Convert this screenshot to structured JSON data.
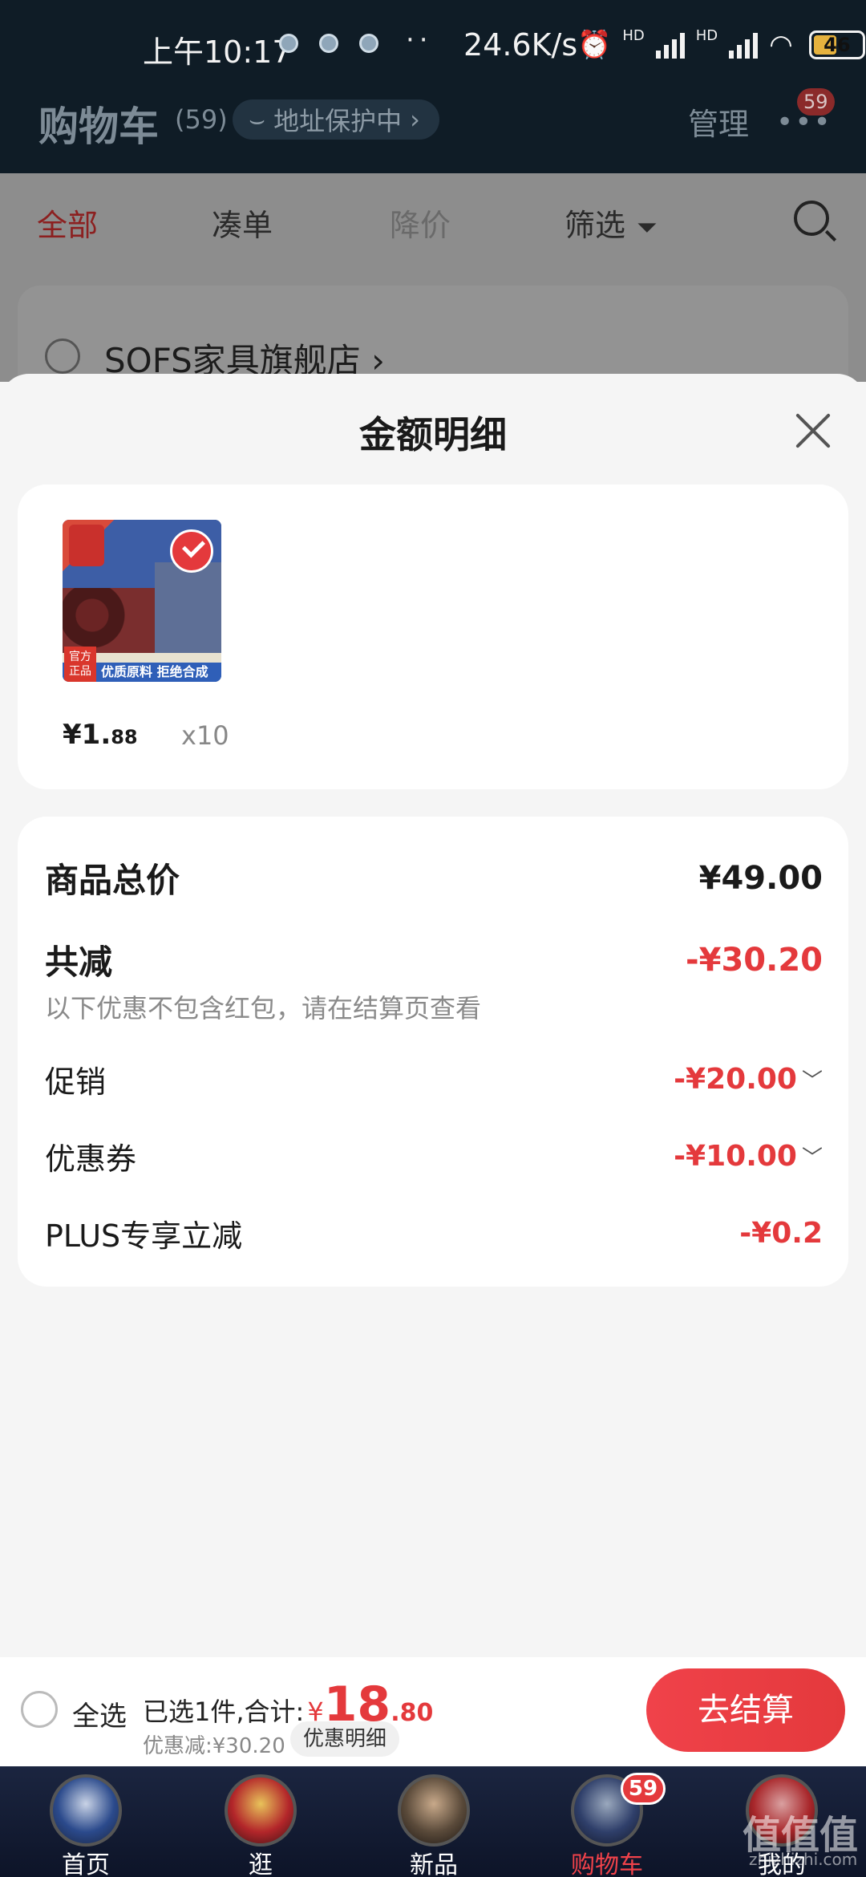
{
  "status_bar": {
    "time": "上午10:17",
    "speed": "24.6K/s",
    "more": "··",
    "hd1": "HD",
    "hd2": "HD",
    "battery": "46"
  },
  "header": {
    "title": "购物车",
    "count": "(59)",
    "address_protect": "地址保护中",
    "address_chevron": "›",
    "manage": "管理",
    "more_badge": "59"
  },
  "tabs": [
    {
      "label": "全部"
    },
    {
      "label": "凑单"
    },
    {
      "label": "降价"
    },
    {
      "label": "筛选"
    }
  ],
  "store": {
    "name": "SOFS家具旗舰店",
    "chevron": "›"
  },
  "sheet": {
    "title": "金额明细",
    "product": {
      "price_int": "¥1.",
      "price_dec": "88",
      "qty": "x10",
      "image_text_official": "官方正品",
      "image_text_banner": "优质原料 拒绝合成"
    },
    "summary": {
      "total_label": "商品总价",
      "total_value": "¥49.00",
      "reduce_label": "共减",
      "reduce_value": "-¥30.20",
      "note": "以下优惠不包含红包，请在结算页查看",
      "promo_label": "促销",
      "promo_value": "-¥20.00",
      "coupon_label": "优惠券",
      "coupon_value": "-¥10.00",
      "plus_label": "PLUS专享立减",
      "plus_value": "-¥0.2"
    }
  },
  "action_bar": {
    "select_all": "全选",
    "selected_text": "已选1件,合计:",
    "yen": "¥",
    "total_int": "18",
    "total_dec": ".80",
    "discount": "优惠减:¥30.20",
    "detail": "优惠明细",
    "checkout": "去结算"
  },
  "nav": [
    {
      "label": "首页"
    },
    {
      "label": "逛"
    },
    {
      "label": "新品"
    },
    {
      "label": "购物车",
      "badge": "59"
    },
    {
      "label": "我的"
    }
  ],
  "watermark": {
    "main": "值值值",
    "sub": "zhizhizhi.com"
  }
}
